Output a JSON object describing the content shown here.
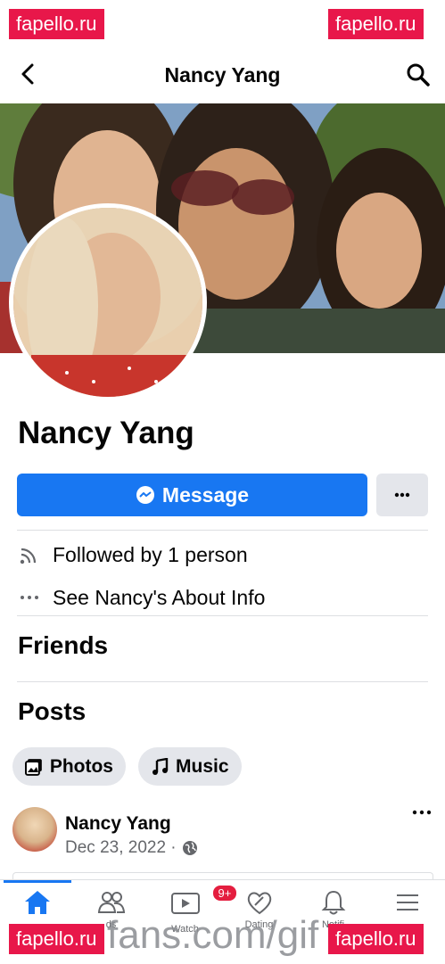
{
  "watermarks": {
    "top_left": "fapello.ru",
    "top_right": "fapello.ru",
    "bottom_left": "fapello.ru",
    "bottom_right": "fapello.ru",
    "bottom_url": "fans.com/gif"
  },
  "header": {
    "title": "Nancy Yang"
  },
  "profile": {
    "name": "Nancy Yang",
    "message_label": "Message",
    "more_label": "•••"
  },
  "info": {
    "followed_by": "Followed by 1 person",
    "about_info": "See Nancy's About Info"
  },
  "sections": {
    "friends": "Friends",
    "posts": "Posts"
  },
  "chips": {
    "photos": "Photos",
    "music": "Music"
  },
  "post": {
    "author": "Nancy Yang",
    "date": "Dec 23, 2022 ·"
  },
  "tabbar": {
    "watch_badge": "9+",
    "labels": {
      "friends": "ds",
      "watch": "Watch",
      "dating": "Dating",
      "notifications": "Notifi"
    }
  },
  "colors": {
    "accent": "#1877f2",
    "badge": "#e41e3f",
    "watermark": "#e8174a"
  }
}
